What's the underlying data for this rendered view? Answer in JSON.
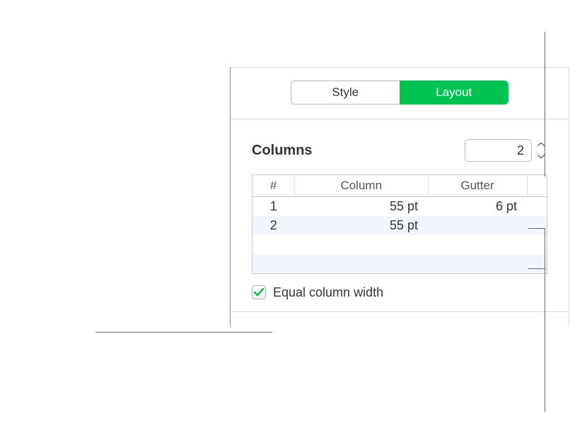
{
  "tabs": {
    "style": "Style",
    "layout": "Layout"
  },
  "columns": {
    "label": "Columns",
    "value": "2"
  },
  "table": {
    "headers": {
      "num": "#",
      "column": "Column",
      "gutter": "Gutter"
    },
    "rows": [
      {
        "num": "1",
        "column": "55 pt",
        "gutter": "6 pt"
      },
      {
        "num": "2",
        "column": "55 pt",
        "gutter": ""
      }
    ]
  },
  "checkbox": {
    "label": "Equal column width",
    "checked": true
  },
  "colors": {
    "accent": "#00c351"
  }
}
